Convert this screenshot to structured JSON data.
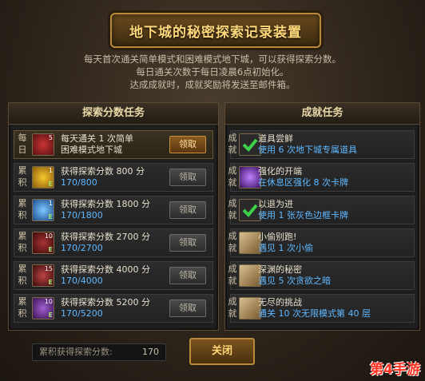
{
  "title": "地下城的秘密探索记录装置",
  "intro": [
    "每天首次通关简单模式和困难模式地下城，可以获得探索分数。",
    "每日通关次数于每日凌晨6点初始化。",
    "达成成就时，成就奖励将发送至邮件箱。"
  ],
  "left_panel": {
    "header": "探索分数任务",
    "rows": [
      {
        "tag": "每日",
        "line1": "每天通关 1 次简单",
        "line2": "困难模式地下城",
        "button": "领取",
        "icon": "sword-icon",
        "num": "5",
        "active": true
      },
      {
        "tag": "累积",
        "line1": "获得探索分数 800 分",
        "line2": "170/800",
        "button": "领取",
        "icon": "gold-icon",
        "num": "1",
        "active": false
      },
      {
        "tag": "累积",
        "line1": "获得探索分数 1800 分",
        "line2": "170/1800",
        "button": "领取",
        "icon": "gift-icon",
        "num": "1",
        "active": false
      },
      {
        "tag": "累积",
        "line1": "获得探索分数 2700 分",
        "line2": "170/2700",
        "button": "领取",
        "icon": "weapon-icon",
        "num": "10",
        "active": false
      },
      {
        "tag": "累积",
        "line1": "获得探索分数 4000 分",
        "line2": "170/4000",
        "button": "领取",
        "icon": "weapon-icon",
        "num": "15",
        "active": false
      },
      {
        "tag": "累积",
        "line1": "获得探索分数 5200 分",
        "line2": "170/5200",
        "button": "领取",
        "icon": "weapon-icon",
        "num": "10",
        "active": false
      }
    ]
  },
  "right_panel": {
    "header": "成就任务",
    "rows": [
      {
        "tag": "成就",
        "line1": "道具尝鲜",
        "line2": "使用 6 次地下城专属道具",
        "icon": "check-icon"
      },
      {
        "tag": "成就",
        "line1": "强化的开端",
        "line2": "在休息区强化 8 次卡牌",
        "icon": "orb-icon"
      },
      {
        "tag": "成就",
        "line1": "以退为进",
        "line2": "使用 1 张灰色边框卡牌",
        "icon": "check-icon"
      },
      {
        "tag": "成就",
        "line1": "小偷别跑!",
        "line2": "遇见 1 次小偷",
        "icon": "scroll-icon"
      },
      {
        "tag": "成就",
        "line1": "深渊的秘密",
        "line2": "遇见 5 次贪欲之暗",
        "icon": "scroll-icon"
      },
      {
        "tag": "成就",
        "line1": "无尽的挑战",
        "line2": "通关 10 次无限模式第 40 层",
        "icon": "scroll-icon"
      }
    ]
  },
  "score": {
    "label": "累积获得探索分数:",
    "value": "170"
  },
  "close_button": "关闭",
  "watermark": "第4手游"
}
